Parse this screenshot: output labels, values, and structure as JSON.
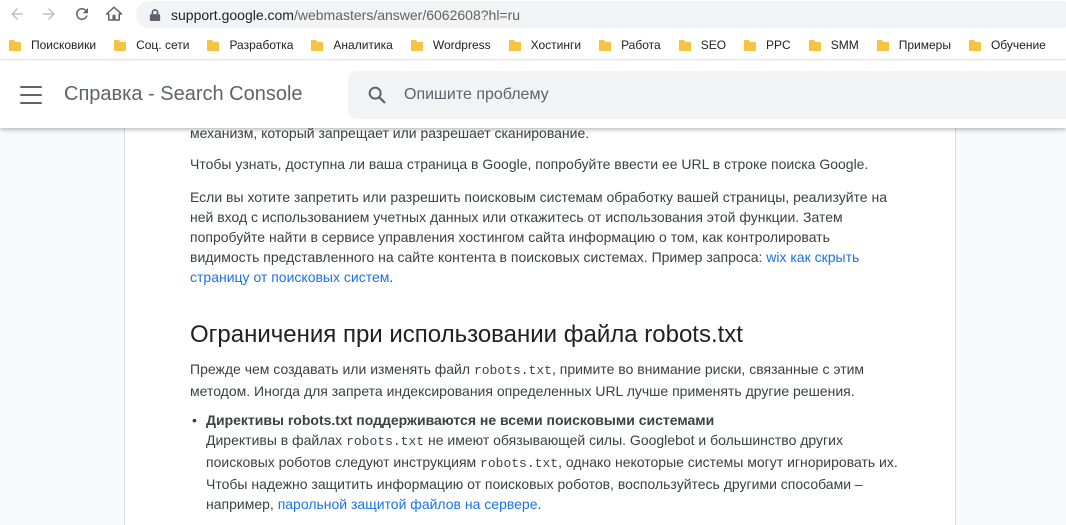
{
  "browser": {
    "url_host": "support.google.com",
    "url_path": "/webmasters/answer/6062608?hl=ru"
  },
  "bookmarks": [
    "Поисковики",
    "Соц. сети",
    "Разработка",
    "Аналитика",
    "Wordpress",
    "Хостинги",
    "Работа",
    "SEO",
    "PPC",
    "SMM",
    "Примеры",
    "Обучение"
  ],
  "header": {
    "title": "Справка - Search Console",
    "search_placeholder": "Опишите проблему"
  },
  "article": {
    "clipped_line": "механизм, который запрещает или разрешает сканирование.",
    "p1": "Чтобы узнать, доступна ли ваша страница в Google, попробуйте ввести ее URL в строке поиска Google.",
    "p2_text": "Если вы хотите запретить или разрешить поисковым системам обработку вашей страницы, реализуйте на ней вход с использованием учетных данных или откажитесь от использования этой функции. Затем попробуйте найти в сервисе управления хостингом сайта информацию о том, как контролировать видимость представленного на сайте контента в поисковых системах. Пример запроса: ",
    "p2_link": "wix как скрыть страницу от поисковых систем",
    "p2_end": ".",
    "heading": "Ограничения при использовании файла robots.txt",
    "p3_before": "Прежде чем создавать или изменять файл ",
    "p3_code": "robots.txt",
    "p3_after": ", примите во внимание риски, связанные с этим методом. Иногда для запрета индексирования определенных URL лучше применять другие решения.",
    "bullet": {
      "dot": "•",
      "title": "Директивы robots.txt поддерживаются не всеми поисковыми системами",
      "t1": "Директивы в файлах ",
      "code1": "robots.txt",
      "t2": " не имеют обязывающей силы. Googlebot и большинство других поисковых роботов следуют инструкциям ",
      "code2": "robots.txt",
      "t3": ", однако некоторые системы могут игнорировать их. Чтобы надежно защитить информацию от поисковых роботов, воспользуйтесь другими способами – например, ",
      "link": "парольной защитой файлов на сервере",
      "end": "."
    }
  },
  "colors": {
    "link": "#1a73e8",
    "folder": "#f6c344",
    "search_bg": "#f1f3f4"
  }
}
